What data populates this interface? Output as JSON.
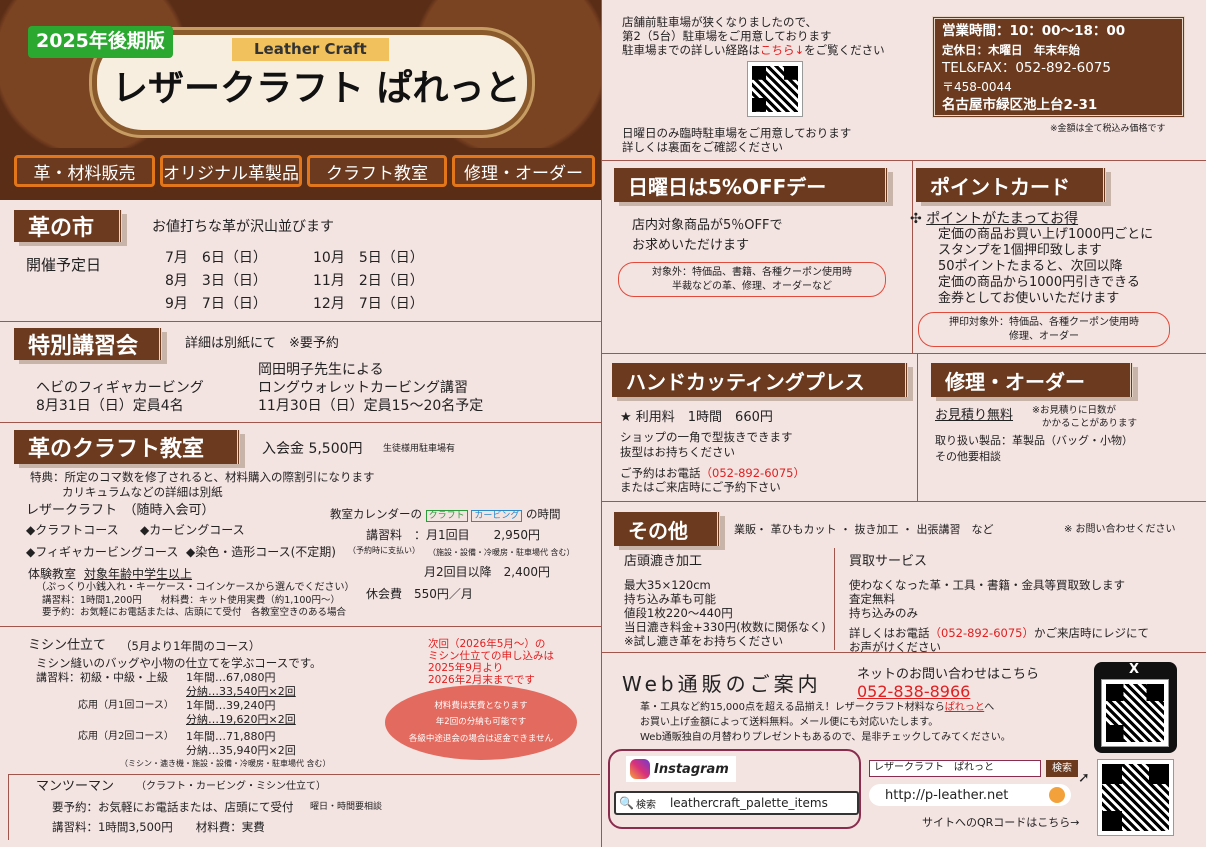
{
  "header": {
    "edition": "2025年後期版",
    "leather_craft": "Leather Craft",
    "shop_name": "レザークラフト ぱれっと",
    "nav": [
      "革・材料販売",
      "オリジナル革製品",
      "クラフト教室",
      "修理・オーダー"
    ]
  },
  "parking": {
    "line1": "店舗前駐車場が狭くなりましたので、",
    "line2": "第2（5台）駐車場をご用意しております",
    "line3_pre": "駐車場までの詳しい経路は",
    "line3_link": "こちら↓",
    "line3_post": "をご覧ください",
    "line4": "日曜日のみ臨時駐車場をご用意しております",
    "line5": "詳しくは裏面をご確認ください"
  },
  "info": {
    "hours": "営業時間：10：00～18：00",
    "closed": "定休日：木曜日　年末年始",
    "tel": "TEL&FAX：052-892-6075",
    "zip": "〒458-0044",
    "address": "名古屋市緑区池上台2-31",
    "tax_note": "※金額は全て税込み価格です"
  },
  "kawa_ichi": {
    "title": "革の市",
    "desc": "お値打ちな革が沢山並びます",
    "label": "開催予定日",
    "dates": [
      "7月　6日（日）",
      "8月　3日（日）",
      "9月　7日（日）",
      "10月　5日（日）",
      "11月　2日（日）",
      "12月　7日（日）"
    ]
  },
  "tokubetsu": {
    "title": "特別講習会",
    "note": "詳細は別紙にて　※要予約",
    "c1_line1": "ヘビのフィギャカービング",
    "c1_line2": "8月31日（日）定員4名",
    "c2_line0": "岡田明子先生による",
    "c2_line1": "ロングウォレットカービング講習",
    "c2_line2": "11月30日（日）定員15～20名予定"
  },
  "kyoshitsu": {
    "title": "革のクラフト教室",
    "fee": "入会金 5,500円",
    "fee_note": "生徒様用駐車場有",
    "tokuten1": "特典：所定のコマ数を修了されると、材料購入の際割引になります",
    "tokuten2": "カリキュラムなどの詳細は別紙",
    "lc_title": "レザークラフト　（随時入会可）",
    "course1": "◆クラフトコース",
    "course2": "◆カービングコース",
    "course3": "◆フィギャカービングコース",
    "course4": "◆染色・造形コース(不定期)",
    "cal_pre": "教室カレンダーの",
    "cal_tag1": "クラフト",
    "cal_tag2": "カービング",
    "cal_post": "の時間",
    "fee_label": "講習料",
    "fee_first": "：月1回目　　2,950円",
    "fee_first_note": "（予約時に支払い）",
    "fee_first_note2": "（施設・設備・冷暖房・駐車場代 含む）",
    "fee_second": "月2回目以降　2,400円",
    "kyukai": "休会費　550円／月",
    "taiken_title": "体験教室",
    "taiken_target": "対象年齢中学生以上",
    "taiken_desc": "（ぷっくり小銭入れ・キーケース・コインケースから選んでください）",
    "taiken_fee": "講習料：1時間1,200円　　材料費：キット使用実費（約1,100円～）",
    "taiken_res": "要予約：お気軽にお電話または、店頭にて受付　各教室空きのある場合"
  },
  "mishin": {
    "title": "ミシン仕立て",
    "period": "（5月より1年間のコース）",
    "desc": "ミシン縫いのバッグや小物の仕立てを学ぶコースです。",
    "fee_label": "講習料：初級・中級・上級",
    "basic1": "1年間…67,080円",
    "basic2": "分納…33,540円×2回",
    "app1_label": "応用（月1回コース）",
    "app1_1": "1年間…39,240円",
    "app1_2": "分納…19,620円×2回",
    "app2_label": "応用（月2回コース）",
    "app2_1": "1年間…71,880円",
    "app2_2": "分納…35,940円×2回",
    "includes": "（ミシン・漉き機・施設・設備・冷暖房・駐車場代 含む）",
    "next1": "次回（2026年5月～）の",
    "next2": "ミシン仕立ての申し込みは",
    "next3": "2025年9月より",
    "next4": "2026年2月末までです",
    "oval1": "材料費は実費となります",
    "oval2": "年2回の分納も可能です",
    "oval3": "各級中途退会の場合は返金できません"
  },
  "mantoman": {
    "title": "マンツーマン",
    "sub": "（クラフト・カービング・ミシン仕立て）",
    "res": "要予約：お気軽にお電話または、店頭にて受付",
    "res_note": "曜日・時間要相談",
    "fee": "講習料：1時間3,500円　　材料費：実費"
  },
  "sunday": {
    "title": "日曜日は5%OFFデー",
    "line1": "店内対象商品が5％OFFで",
    "line2": "お求めいただけます",
    "ex1": "対象外：特価品、書籍、各種クーポン使用時",
    "ex2": "半裁などの革、修理、オーダーなど"
  },
  "point": {
    "title": "ポイントカード",
    "head": "ポイントがたまってお得",
    "l1": "定価の商品お買い上げ1000円ごとに",
    "l2": "スタンプを1個押印致します",
    "l3": "50ポイントたまると、次回以降",
    "l4": "定価の商品から1000円引きできる",
    "l5": "金券としてお使いいただけます",
    "ex1": "押印対象外：特価品、各種クーポン使用時",
    "ex2": "修理、オーダー"
  },
  "press": {
    "title": "ハンドカッティングプレス",
    "fee": "★ 利用料　1時間　660円",
    "l1": "ショップの一角で型抜きできます",
    "l2": "抜型はお持ちください",
    "res_pre": "ご予約はお電話",
    "res_tel": "（052-892-6075）",
    "res2": "またはご来店時にご予約下さい"
  },
  "repair": {
    "title": "修理・オーダー",
    "estimate": "お見積り無料",
    "est_note1": "※お見積りに日数が",
    "est_note2": "かかることがあります",
    "l1": "取り扱い製品：革製品（バッグ・小物）",
    "l2": "その他要相談"
  },
  "sonota": {
    "title": "その他",
    "desc": "業販・ 革ひもカット ・ 抜き加工 ・ 出張講習　など",
    "inquiry": "※ お問い合わせください",
    "suki_title": "店頭漉き加工",
    "s1": "最大35×120cm",
    "s2": "持ち込み革も可能",
    "s3": "値段1枚220～440円",
    "s4": "当日漉き料金+330円(枚数に関係なく)",
    "s5": "※試し漉き革をお持ちください",
    "kaitori_title": "買取サービス",
    "k1": "使わなくなった革・工具・書籍・金具等買取致します",
    "k2": "査定無料",
    "k3": "持ち込みのみ",
    "k4_pre": "詳しくはお電話",
    "k4_tel": "（052-892-6075）",
    "k4_post": "かご来店時にレジにて",
    "k5": "お声がけください"
  },
  "web": {
    "title": "Web通販のご案内",
    "net_q": "ネットのお問い合わせはこちら",
    "net_tel": "052-838-8966",
    "d1_pre": "革・工具など約15,000点を超える品揃え！レザークラフト材料なら",
    "d1_link": "ぱれっと",
    "d1_post": "へ",
    "d2": "お買い上げ金額によって送料無料。メール便にも対応いたします。",
    "d3": "Web通販独自の月替わりプレゼントもあるので、是非チェックしてみてください。",
    "x_label": "X",
    "instagram": "Instagram",
    "search_label": "検索",
    "insta_id": "leathercraft_palette_items",
    "site_search_text": "レザークラフト　ぱれっと",
    "site_search_btn": "検索",
    "url": "http://p-leather.net",
    "qr_note": "サイトへのQRコードはこちら→"
  }
}
